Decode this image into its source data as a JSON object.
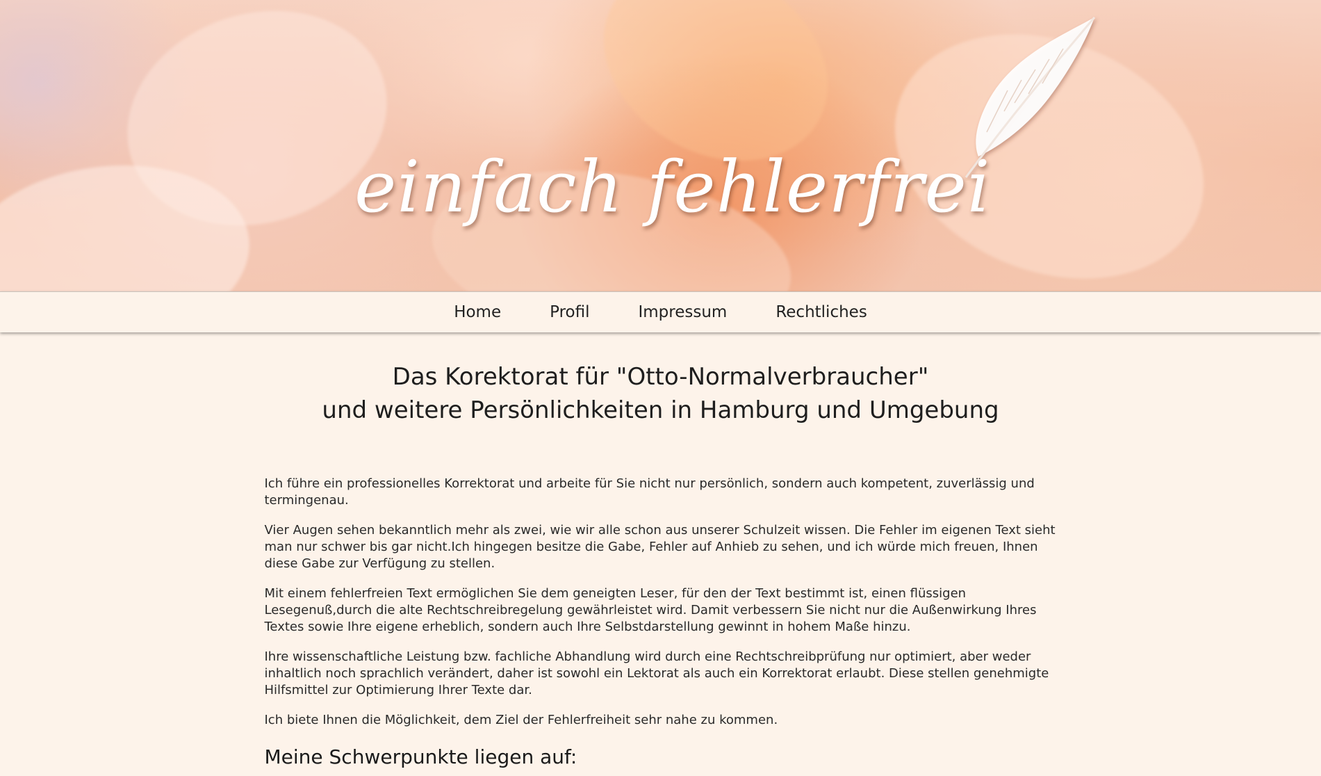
{
  "header": {
    "logo_text": "einfach fehlerfrei",
    "feather_icon": "feather-quill-icon"
  },
  "nav": {
    "items": [
      {
        "label": "Home"
      },
      {
        "label": "Profil"
      },
      {
        "label": "Impressum"
      },
      {
        "label": "Rechtliches"
      }
    ]
  },
  "main": {
    "headline_line1": "Das Korektorat für \"Otto-Normalverbraucher\"",
    "headline_line2": "und weitere Persönlichkeiten in Hamburg und Umgebung",
    "paragraphs": [
      "Ich führe ein professionelles Korrektorat und arbeite für Sie nicht nur persönlich, sondern auch kompetent, zuverlässig und termingenau.",
      "Vier Augen sehen bekanntlich mehr als zwei, wie wir alle schon aus unserer Schulzeit wissen. Die Fehler im eigenen Text sieht man nur schwer bis gar nicht.Ich hingegen besitze die Gabe, Fehler auf Anhieb zu sehen, und ich würde mich freuen, Ihnen diese Gabe zur Verfügung zu stellen.",
      "Mit einem fehlerfreien Text ermöglichen Sie dem geneigten Leser, für den der Text bestimmt ist, einen flüssigen Lesegenuß,durch die alte Rechtschreibregelung gewährleistet wird. Damit verbessern Sie nicht nur die Außenwirkung Ihres Textes sowie Ihre eigene erheblich, sondern auch Ihre Selbstdarstellung gewinnt in hohem Maße hinzu.",
      "Ihre wissenschaftliche Leistung bzw. fachliche Abhandlung wird durch eine Rechtschreibprüfung nur optimiert, aber weder inhaltlich noch sprachlich verändert, daher ist sowohl ein Lektorat als auch ein Korrektorat erlaubt. Diese stellen genehmigte Hilfsmittel zur Optimierung Ihrer Texte dar.",
      "Ich biete Ihnen die Möglichkeit, dem Ziel der Fehlerfreiheit sehr nahe zu kommen."
    ],
    "subheading": "Meine Schwerpunkte liegen auf:"
  },
  "colors": {
    "background": "#fdf3ea",
    "text": "#1e1e1e",
    "logo": "#ffffff"
  }
}
